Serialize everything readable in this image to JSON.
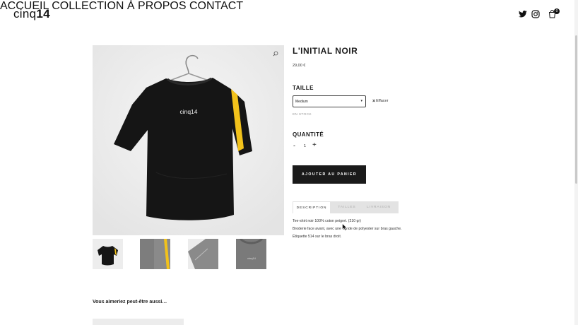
{
  "header": {
    "logo_light": "cinq",
    "logo_bold": "14",
    "nav": [
      "ACCUEIL",
      "COLLECTION",
      "À PROPOS",
      "CONTACT"
    ],
    "cart_count": "0",
    "icons": [
      "twitter-icon",
      "instagram-icon",
      "shopping-bag-icon"
    ]
  },
  "product": {
    "title": "L'INITIAL NOIR",
    "price": "29,00 €",
    "image_print": "cinq14",
    "size_label": "TAILLE",
    "size_selected": "Medium",
    "clear_label": "Effacer",
    "stock": "EN STOCK",
    "quantity_label": "QUANTITÉ",
    "quantity": "1",
    "qty_minus": "-",
    "qty_plus": "+",
    "add_to_cart": "AJOUTER AU PANIER"
  },
  "tabs": [
    "DESCRIPTION",
    "TAILLES",
    "LIVRAISON"
  ],
  "description": [
    "Tee-shirt noir 100% coton peigné. (210 gr)",
    "Broderie face avant, avec une bande de polyester sur bras gauche.",
    "Étiquette 514 sur le bras droit."
  ],
  "related": {
    "title": "Vous aimeriez peut-être aussi…"
  },
  "colors": {
    "accent": "#1a1a1a",
    "stripe": "#f2c21b",
    "tab_inactive_bg": "#e3e3e3"
  }
}
